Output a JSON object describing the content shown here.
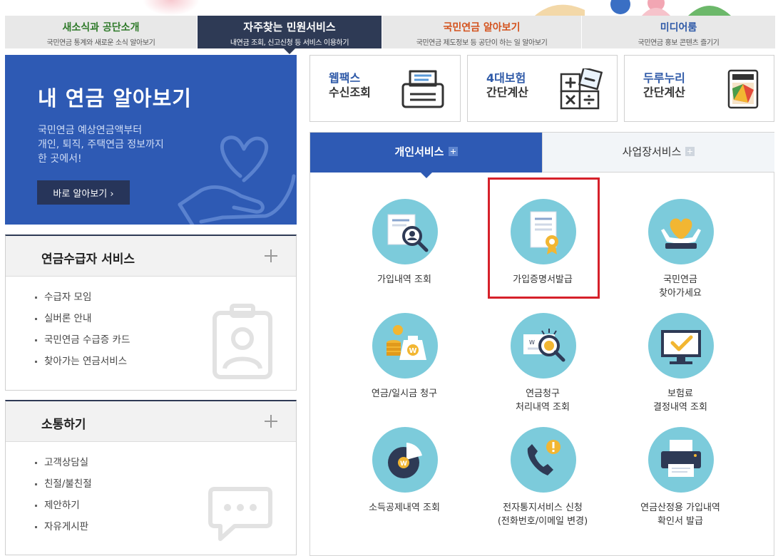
{
  "top_tabs": [
    {
      "title": "새소식과 공단소개",
      "sub": "국민연금 통계와 새로운 소식 알아보기"
    },
    {
      "title": "자주찾는 민원서비스",
      "sub": "내연금 조회, 신고신청 등 서비스 이용하기"
    },
    {
      "title": "국민연금 알아보기",
      "sub": "국민연금 제도정보 등 공단이 하는 일 알아보기"
    },
    {
      "title": "미디어룸",
      "sub": "국민연금 홍보 콘텐츠 즐기기"
    }
  ],
  "hero": {
    "title": "내 연금 알아보기",
    "desc": [
      "국민연금 예상연금액부터",
      "개인, 퇴직, 주택연금 정보까지",
      "한 곳에서!"
    ],
    "button": "바로 알아보기 ›"
  },
  "panels": {
    "pension": {
      "title": "연금수급자 서비스",
      "items": [
        "수급자 모임",
        "실버론 안내",
        "국민연금 수급증 카드",
        "찾아가는 연금서비스"
      ]
    },
    "comm": {
      "title": "소통하기",
      "items": [
        "고객상담실",
        "친절/불친절",
        "제안하기",
        "자유게시판"
      ]
    }
  },
  "quick": [
    {
      "l1": "웹팩스",
      "l2": "수신조회",
      "icon": "fax-icon"
    },
    {
      "l1": "4대보험",
      "l2": "간단계산",
      "icon": "calculator-icon"
    },
    {
      "l1": "두루누리",
      "l2": "간단계산",
      "icon": "duru-nuri-icon"
    }
  ],
  "service_tabs": [
    "개인서비스",
    "사업장서비스"
  ],
  "services": [
    {
      "label": [
        "가입내역 조회"
      ],
      "icon": "document-search-icon"
    },
    {
      "label": [
        "가입증명서발급"
      ],
      "icon": "certificate-icon"
    },
    {
      "label": [
        "국민연금",
        "찾아가세요"
      ],
      "icon": "heart-hands-icon"
    },
    {
      "label": [
        "연금/일시금 청구"
      ],
      "icon": "money-bag-icon"
    },
    {
      "label": [
        "연금청구",
        "처리내역 조회"
      ],
      "icon": "claim-search-icon"
    },
    {
      "label": [
        "보험료",
        "결정내역 조회"
      ],
      "icon": "monitor-check-icon"
    },
    {
      "label": [
        "소득공제내역 조회"
      ],
      "icon": "pie-chart-icon"
    },
    {
      "label": [
        "전자통지서비스 신청",
        "(전화번호/이메일 변경)"
      ],
      "icon": "phone-alert-icon"
    },
    {
      "label": [
        "연금산정용 가입내역",
        "확인서 발급"
      ],
      "icon": "printer-icon"
    }
  ],
  "colors": {
    "accent": "#2e5ab4",
    "dark_navy": "#2e3a55",
    "icon_circle": "#7ccbdb",
    "highlight": "#d6212a"
  }
}
